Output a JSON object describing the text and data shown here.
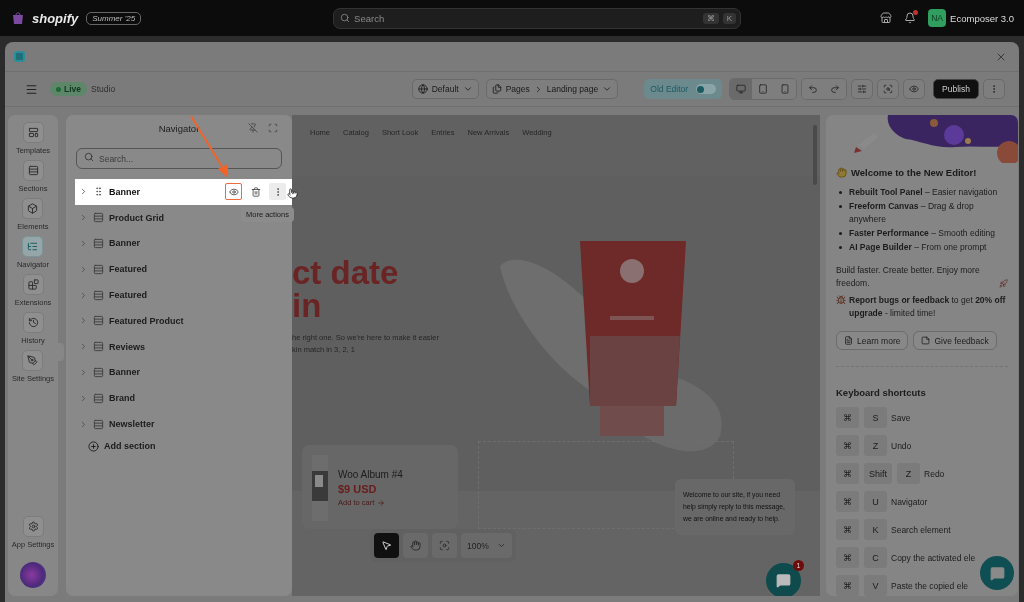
{
  "topbar": {
    "brand": "shopify",
    "edition_badge": "Summer '25",
    "search": {
      "placeholder": "Search",
      "shortcut": [
        "⌘",
        "K"
      ]
    },
    "avatar": "NA",
    "store_name": "Ecomposer 3.0"
  },
  "toolbar": {
    "status": "Live",
    "mode": "Studio",
    "theme_select": "Default",
    "page_path": [
      "Pages",
      "Landing page"
    ],
    "old_editor": {
      "label": "Old Editor",
      "on": false
    },
    "devices": [
      {
        "kind": "desktop",
        "selected": true
      },
      {
        "kind": "tablet",
        "selected": false
      },
      {
        "kind": "mobile",
        "selected": false
      }
    ],
    "publish": "Publish"
  },
  "sidebar": {
    "items": [
      {
        "kind": "templates",
        "label": "Templates",
        "selected": false
      },
      {
        "kind": "sections",
        "label": "Sections",
        "selected": false
      },
      {
        "kind": "elements",
        "label": "Elements",
        "selected": false
      },
      {
        "kind": "navigator",
        "label": "Navigator",
        "selected": true
      },
      {
        "kind": "extensions",
        "label": "Extensions",
        "selected": false
      },
      {
        "kind": "history",
        "label": "History",
        "selected": false
      },
      {
        "kind": "site",
        "label": "Site Settings",
        "selected": false
      }
    ],
    "footer_label": "App Settings"
  },
  "navigator": {
    "title": "Navigator",
    "search": {
      "placeholder": "Search..."
    },
    "rows": [
      {
        "label": "Banner",
        "selected": true
      },
      {
        "label": "Product Grid",
        "selected": false
      },
      {
        "label": "Banner",
        "selected": false
      },
      {
        "label": "Featured",
        "selected": false
      },
      {
        "label": "Featured",
        "selected": false
      },
      {
        "label": "Featured Product",
        "selected": false
      },
      {
        "label": "Reviews",
        "selected": false
      },
      {
        "label": "Banner",
        "selected": false
      },
      {
        "label": "Brand",
        "selected": false
      },
      {
        "label": "Newsletter",
        "selected": false
      }
    ],
    "tooltip": "More actions",
    "add_label": "Add section"
  },
  "canvas": {
    "nav_links": [
      "Home",
      "Catalog",
      "Short Look",
      "Entries",
      "New Arrivals",
      "Wedding"
    ],
    "hero_title": [
      "ct date",
      "in"
    ],
    "hero_text": [
      "he right one. So we're here to make it easier",
      "kin match in 3, 2, 1"
    ],
    "product_card": {
      "title": "Woo Album #4",
      "price": "$9 USD",
      "action": "Add to cart"
    },
    "tools": [
      {
        "kind": "pointer",
        "selected": true
      },
      {
        "kind": "hand",
        "selected": false
      },
      {
        "kind": "focus",
        "selected": false
      }
    ],
    "zoom": "100%",
    "chat_message": "Welcome to our site, if you need help simply reply to this message, we are online and ready to help.",
    "chat_badge": "1"
  },
  "welcome": {
    "title": "Welcome to the New Editor!",
    "features": [
      "**Rebuilt Tool Panel** – Easier navigation",
      "**Freeform Canvas** – Drag & drop anywhere",
      "**Faster Performance** – Smooth editing",
      "**AI Page Builder** – From one prompt"
    ],
    "tagline": "Build faster. Create better. Enjoy more freedom.",
    "promo": "**Report bugs or feedback** to get **20% off upgrade** - limited time!",
    "buttons": [
      {
        "kind": "learn",
        "label": "Learn more"
      },
      {
        "kind": "feedback",
        "label": "Give feedback"
      }
    ]
  },
  "shortcuts": {
    "title": "Keyboard shortcuts",
    "items": [
      {
        "keys": [
          "⌘",
          "S"
        ],
        "action": "Save"
      },
      {
        "keys": [
          "⌘",
          "Z"
        ],
        "action": "Undo"
      },
      {
        "keys": [
          "⌘",
          "Shift",
          "Z"
        ],
        "action": "Redo"
      },
      {
        "keys": [
          "⌘",
          "U"
        ],
        "action": "Navigator"
      },
      {
        "keys": [
          "⌘",
          "K"
        ],
        "action": "Search element"
      },
      {
        "keys": [
          "⌘",
          "C"
        ],
        "action": "Copy the activated ele"
      },
      {
        "keys": [
          "⌘",
          "V"
        ],
        "action": "Paste the copied ele"
      }
    ]
  }
}
